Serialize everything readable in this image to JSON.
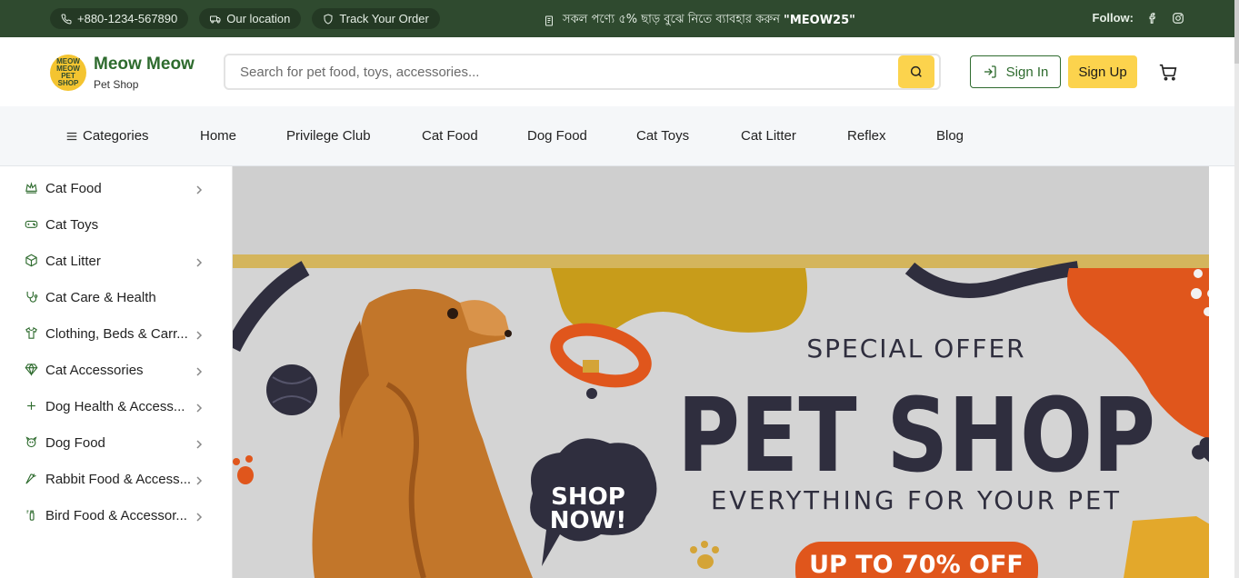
{
  "topbar": {
    "phone": "+880-1234-567890",
    "location": "Our location",
    "track": "Track Your Order",
    "promo_text": "সকল পণ্যে ৫% ছাড় বুঝে নিতে ব্যাবহার করুন",
    "promo_code": "\"MEOW25\"",
    "follow": "Follow:"
  },
  "header": {
    "brand_name": "Meow Meow",
    "brand_sub": "Pet Shop",
    "logo_text": "MEOW MEOW PET SHOP",
    "search_placeholder": "Search for pet food, toys, accessories...",
    "sign_in": "Sign In",
    "sign_up": "Sign Up"
  },
  "nav": {
    "categories": "Categories",
    "items": [
      "Home",
      "Privilege Club",
      "Cat Food",
      "Dog Food",
      "Cat Toys",
      "Cat Litter",
      "Reflex",
      "Blog"
    ]
  },
  "sidebar": {
    "items": [
      {
        "label": "Cat Food",
        "icon": "crown-icon",
        "has_children": true
      },
      {
        "label": "Cat Toys",
        "icon": "gamepad-icon",
        "has_children": false
      },
      {
        "label": "Cat Litter",
        "icon": "box-icon",
        "has_children": true
      },
      {
        "label": "Cat Care & Health",
        "icon": "stethoscope-icon",
        "has_children": false
      },
      {
        "label": "Clothing, Beds & Carr...",
        "icon": "shirt-icon",
        "has_children": true
      },
      {
        "label": "Cat Accessories",
        "icon": "gem-icon",
        "has_children": true
      },
      {
        "label": "Dog Health & Access...",
        "icon": "plus-icon",
        "has_children": true
      },
      {
        "label": "Dog Food",
        "icon": "dog-icon",
        "has_children": true
      },
      {
        "label": "Rabbit Food & Access...",
        "icon": "carrot-icon",
        "has_children": true
      },
      {
        "label": "Bird Food & Accessor...",
        "icon": "bird-icon",
        "has_children": true
      }
    ]
  },
  "banner": {
    "line1": "SPECIAL OFFER",
    "line2": "PET SHOP",
    "line3": "EVERYTHING FOR YOUR PET",
    "cta": "UP TO 70% OFF",
    "bubble_1": "SHOP",
    "bubble_2": "NOW!"
  },
  "colors": {
    "topbar_bg": "#2f4a2f",
    "brand_green": "#2e6b2e",
    "accent_yellow": "#fcd34d",
    "banner_orange": "#e0561c",
    "banner_navy": "#2f2e3e"
  }
}
